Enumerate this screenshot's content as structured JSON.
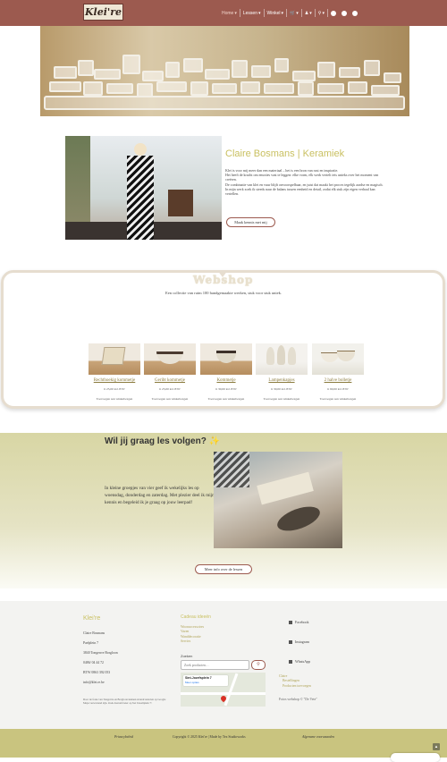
{
  "header": {
    "logo_text": "Klei're",
    "nav": [
      {
        "label": "Home",
        "active": true,
        "chevron": true
      },
      {
        "label": "Lessen",
        "chevron": true
      },
      {
        "label": "Winkel",
        "chevron": true
      }
    ],
    "icons": [
      "cart-icon",
      "user-icon",
      "search-icon",
      "facebook-icon",
      "instagram-icon",
      "whatsapp-icon"
    ]
  },
  "intro": {
    "title": "Claire Bosmans | Keramiek",
    "paragraphs": [
      "Klei is voor mij meer dan een materiaal – het is een bron van rust en inspiratie.",
      "Het heeft de kracht om emoties vast te leggen: elke vorm, elk werk vertelt iets unieks over het moment van creëren.",
      "De combinatie van klei en vuur blijft onvoorspelbaar, en juist dat maakt het proces tegelijk aardse en magisch.",
      "In mijn werk zoek ik steeds naar de balans tussen eenheid en detail, zodat elk stuk zijn eigen verhaal kan vertellen."
    ],
    "button_label": "Maak kennis met mij"
  },
  "shop": {
    "title": "Webshop",
    "subtitle": "Een collectie van ruim 100 handgemaakte werken, stuk voor stuk uniek.",
    "products": [
      {
        "name": "Rechthoekig kommetje",
        "price": "€ 25,00",
        "tax": "incl. BTW",
        "link": "Toevoegen aan winkelwagen"
      },
      {
        "name": "Geribt kommetje",
        "price": "€ 25,00",
        "tax": "incl. BTW",
        "link": "Toevoegen aan winkelwagen"
      },
      {
        "name": "Kommetje",
        "price": "€ 30,00",
        "tax": "incl. BTW",
        "link": "Toevoegen aan winkelwagen"
      },
      {
        "name": "Lampenkapjes",
        "price": "€ 30,00",
        "tax": "incl. BTW",
        "link": "Toevoegen aan winkelwagen"
      },
      {
        "name": "2 halve bolletje",
        "price": "€ 90,00",
        "tax": "incl. BTW",
        "link": "Toevoegen aan winkelwagen"
      }
    ]
  },
  "lessons": {
    "title": "Wil jij graag les volgen? ✨",
    "text": "In kleine groepjes van vier geef ik wekelijks les op woensdag, donderdag en zaterdag. Met plezier deel ik mijn kennis en begeleid ik je graag op jouw leerpad!",
    "button_label": "Meer info over de lessen"
  },
  "footer": {
    "brand": "Klei're",
    "lines": [
      "Claire Bosmans",
      "Paelplein 7",
      "3840 Tongerrre Borgloon",
      "0486/ 04 44 72",
      "BTW 0863 392 053",
      "info@klei.re.be"
    ],
    "note": "Door de foute van Tongerrre en Borgloon kunnen strandcontacten op Google Maps verwarrend zijn. Zoek daarom beter op 'het Juweliplein 7'.",
    "gifts_heading": "Cadeau ideeën",
    "gifts": [
      "Woonaccessoires",
      "Vazen",
      "Wanddecoratie",
      "Servies"
    ],
    "search_heading": "Zoeken",
    "search_placeholder": "Zoek producten…",
    "map_label": "Sint-Jozefsplein 7",
    "map_link": "Meer opties",
    "social": [
      "Facebook",
      "Instagram",
      "WhatsApp"
    ],
    "account": [
      "Claire",
      "Bestellingen",
      "Producten toevoegen"
    ],
    "credit": "Fotos webshop © \"De Vete\""
  },
  "bottom": {
    "privacy": "Privacybeleid",
    "copyright": "Copyright © 2025 Klei're | Made by Tex Studioworks",
    "terms": "Algemene voorwaarden"
  }
}
